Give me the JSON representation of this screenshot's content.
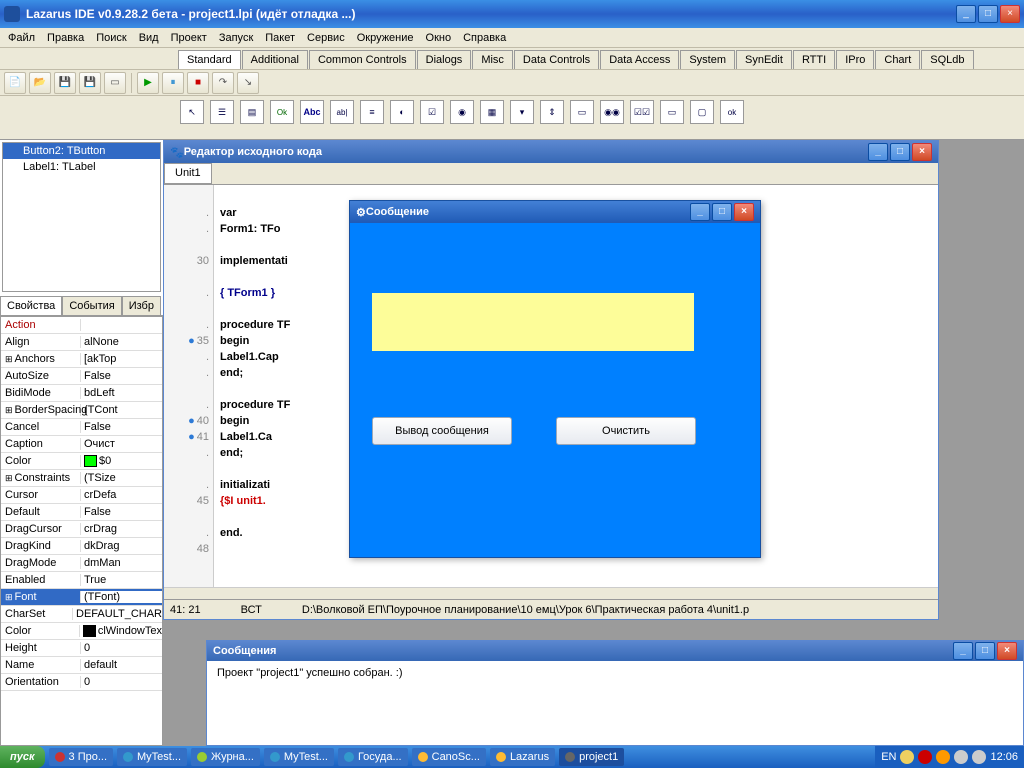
{
  "window": {
    "title": "Lazarus IDE v0.9.28.2 бета - project1.lpi (идёт отладка ...)"
  },
  "menu": [
    "Файл",
    "Правка",
    "Поиск",
    "Вид",
    "Проект",
    "Запуск",
    "Пакет",
    "Сервис",
    "Окружение",
    "Окно",
    "Справка"
  ],
  "palette_tabs": [
    "Standard",
    "Additional",
    "Common Controls",
    "Dialogs",
    "Misc",
    "Data Controls",
    "Data Access",
    "System",
    "SynEdit",
    "RTTI",
    "IPro",
    "Chart",
    "SQLdb"
  ],
  "palette_active": "Standard",
  "tree": [
    {
      "label": "Button2: TButton",
      "sel": true
    },
    {
      "label": "Label1: TLabel",
      "sel": false
    }
  ],
  "prop_tabs": [
    "Свойства",
    "События",
    "Избр"
  ],
  "props": [
    {
      "k": "Action",
      "v": "",
      "action": true
    },
    {
      "k": "Align",
      "v": "alNone"
    },
    {
      "k": "Anchors",
      "v": "[akTop",
      "exp": true
    },
    {
      "k": "AutoSize",
      "v": "False"
    },
    {
      "k": "BidiMode",
      "v": "bdLeft"
    },
    {
      "k": "BorderSpacing",
      "v": "(TCont",
      "exp": true
    },
    {
      "k": "Cancel",
      "v": "False"
    },
    {
      "k": "Caption",
      "v": "Очист"
    },
    {
      "k": "Color",
      "v": "$0",
      "swatch": "#00ff00"
    },
    {
      "k": "Constraints",
      "v": "(TSize",
      "exp": true
    },
    {
      "k": "Cursor",
      "v": "crDefa"
    },
    {
      "k": "Default",
      "v": "False"
    },
    {
      "k": "DragCursor",
      "v": "crDrag"
    },
    {
      "k": "DragKind",
      "v": "dkDrag"
    },
    {
      "k": "DragMode",
      "v": "dmMan"
    },
    {
      "k": "Enabled",
      "v": "True"
    },
    {
      "k": "Font",
      "v": "(TFont)",
      "exp": true,
      "sel": true
    },
    {
      "k": "  CharSet",
      "v": "DEFAULT_CHAR"
    },
    {
      "k": "  Color",
      "v": "clWindowTex",
      "swatch": "#000"
    },
    {
      "k": "  Height",
      "v": "0"
    },
    {
      "k": "  Name",
      "v": "default"
    },
    {
      "k": "  Orientation",
      "v": "0"
    }
  ],
  "code_editor": {
    "title": "Редактор исходного кода",
    "tab": "Unit1",
    "lines": [
      {
        "n": "",
        "t": ""
      },
      {
        "n": ".",
        "t": "var",
        "cls": "kw"
      },
      {
        "n": ".",
        "t": "  Form1: TFo"
      },
      {
        "n": "",
        "t": ""
      },
      {
        "n": "30",
        "t": "implementati",
        "cls": "kw"
      },
      {
        "n": "",
        "t": ""
      },
      {
        "n": ".",
        "t": "{ TForm1 }",
        "cls": "cm"
      },
      {
        "n": "",
        "t": ""
      },
      {
        "n": ".",
        "t": "procedure TF",
        "cls": "kw"
      },
      {
        "n": "35",
        "bp": true,
        "t": "begin",
        "cls": "kw"
      },
      {
        "n": ".",
        "t": "  Label1.Cap"
      },
      {
        "n": ".",
        "t": "end;",
        "cls": "kw"
      },
      {
        "n": "",
        "t": ""
      },
      {
        "n": ".",
        "t": "procedure TF",
        "cls": "kw"
      },
      {
        "n": "40",
        "bp": true,
        "t": "begin",
        "cls": "kw"
      },
      {
        "n": "41",
        "bp": true,
        "t": "  Label1.Ca"
      },
      {
        "n": ".",
        "t": "end;",
        "cls": "kw"
      },
      {
        "n": "",
        "t": ""
      },
      {
        "n": ".",
        "t": "initializati",
        "cls": "kw"
      },
      {
        "n": "45",
        "t": "  {$I unit1.",
        "cls": "dir"
      },
      {
        "n": "",
        "t": ""
      },
      {
        "n": ".",
        "t": "end.",
        "cls": "kw"
      },
      {
        "n": "48",
        "t": ""
      }
    ],
    "status_pos": "41: 21",
    "status_mode": "ВСТ",
    "status_path": "D:\\Волковой ЕП\\Поурочное планирование\\10 емц\\Урок 6\\Практическая работа 4\\unit1.p"
  },
  "form_window": {
    "title": "Сообщение",
    "btn1": "Вывод сообщения",
    "btn2": "Очистить"
  },
  "messages": {
    "title": "Сообщения",
    "text": "Проект \"project1\" успешно собран. :)"
  },
  "taskbar": {
    "start": "пуск",
    "tasks": [
      "3 Про...",
      "MyTest...",
      "Журна...",
      "MyTest...",
      "Госуда...",
      "CanoSc...",
      "Lazarus",
      "project1"
    ],
    "lang": "EN",
    "time": "12:06"
  }
}
